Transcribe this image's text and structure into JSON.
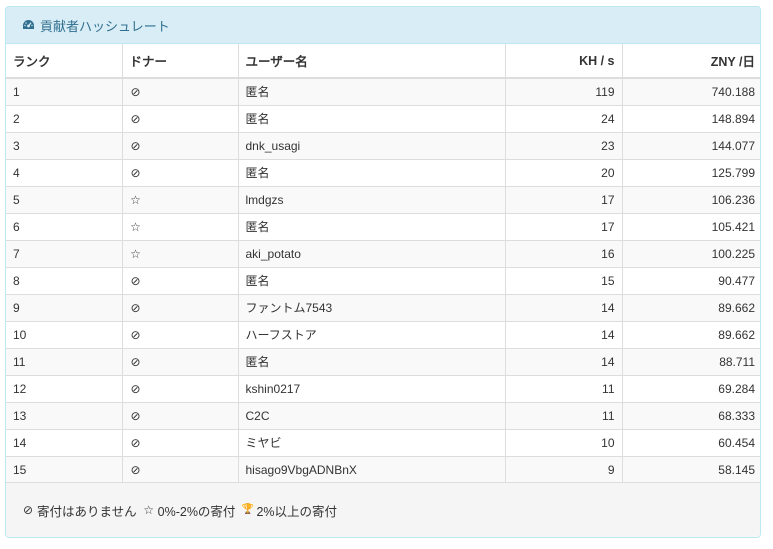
{
  "panel": {
    "title": "貢献者ハッシュレート",
    "title_icon": "dashboard-icon"
  },
  "table": {
    "columns": [
      "ランク",
      "ドナー",
      "ユーザー名",
      "KH / s",
      "ZNY /日"
    ],
    "rows": [
      {
        "rank": "1",
        "donor": "none",
        "donor_glyph": "⊘",
        "user": "匿名",
        "khs": "119",
        "zny": "740.188"
      },
      {
        "rank": "2",
        "donor": "none",
        "donor_glyph": "⊘",
        "user": "匿名",
        "khs": "24",
        "zny": "148.894"
      },
      {
        "rank": "3",
        "donor": "none",
        "donor_glyph": "⊘",
        "user": "dnk_usagi",
        "khs": "23",
        "zny": "144.077"
      },
      {
        "rank": "4",
        "donor": "none",
        "donor_glyph": "⊘",
        "user": "匿名",
        "khs": "20",
        "zny": "125.799"
      },
      {
        "rank": "5",
        "donor": "star",
        "donor_glyph": "☆",
        "user": "lmdgzs",
        "khs": "17",
        "zny": "106.236"
      },
      {
        "rank": "6",
        "donor": "star",
        "donor_glyph": "☆",
        "user": "匿名",
        "khs": "17",
        "zny": "105.421"
      },
      {
        "rank": "7",
        "donor": "star",
        "donor_glyph": "☆",
        "user": "aki_potato",
        "khs": "16",
        "zny": "100.225"
      },
      {
        "rank": "8",
        "donor": "none",
        "donor_glyph": "⊘",
        "user": "匿名",
        "khs": "15",
        "zny": "90.477"
      },
      {
        "rank": "9",
        "donor": "none",
        "donor_glyph": "⊘",
        "user": "ファントム7543",
        "khs": "14",
        "zny": "89.662"
      },
      {
        "rank": "10",
        "donor": "none",
        "donor_glyph": "⊘",
        "user": "ハーフストア",
        "khs": "14",
        "zny": "89.662"
      },
      {
        "rank": "11",
        "donor": "none",
        "donor_glyph": "⊘",
        "user": "匿名",
        "khs": "14",
        "zny": "88.711"
      },
      {
        "rank": "12",
        "donor": "none",
        "donor_glyph": "⊘",
        "user": "kshin0217",
        "khs": "11",
        "zny": "69.284"
      },
      {
        "rank": "13",
        "donor": "none",
        "donor_glyph": "⊘",
        "user": "C2C",
        "khs": "11",
        "zny": "68.333"
      },
      {
        "rank": "14",
        "donor": "none",
        "donor_glyph": "⊘",
        "user": "ミヤビ",
        "khs": "10",
        "zny": "60.454"
      },
      {
        "rank": "15",
        "donor": "none",
        "donor_glyph": "⊘",
        "user": "hisago9VbgADNBnX",
        "khs": "9",
        "zny": "58.145"
      }
    ]
  },
  "legend": {
    "none_glyph": "⊘",
    "none_label": "寄付はありません",
    "star_glyph": "☆",
    "star_label": "0%-2%の寄付",
    "trophy_glyph": "🏆",
    "trophy_label": "2%以上の寄付"
  },
  "colors": {
    "heading_bg": "#d9edf7",
    "heading_text": "#31708f",
    "border": "#bce8f1"
  }
}
